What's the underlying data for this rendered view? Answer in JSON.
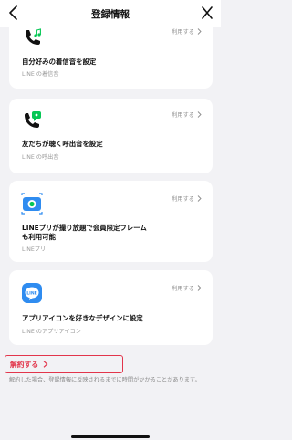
{
  "header": {
    "title": "登録情報"
  },
  "cards": [
    {
      "use_label": "利用する",
      "title": "自分好みの着信音を設定",
      "subtitle": "LINE の着信音"
    },
    {
      "use_label": "利用する",
      "title": "友だちが聴く呼出音を設定",
      "subtitle": "LINE の呼出音"
    },
    {
      "use_label": "利用する",
      "title_line1": "LINEプリが撮り放題で会員限定フレーム",
      "title_line2": "も利用可能",
      "subtitle": "LINEプリ"
    },
    {
      "use_label": "利用する",
      "title": "アプリアイコンを好きなデザインに設定",
      "subtitle": "LINE のアプリアイコン",
      "icon_text": "LINE"
    }
  ],
  "cancel": {
    "label": "解約する"
  },
  "note": {
    "text": "解約した場合、登録情報に反映されるまでに時間がかかることがあります。"
  },
  "colors": {
    "accent_red": "#e2354b",
    "line_green": "#06c755",
    "line_blue": "#2f8cf0"
  }
}
